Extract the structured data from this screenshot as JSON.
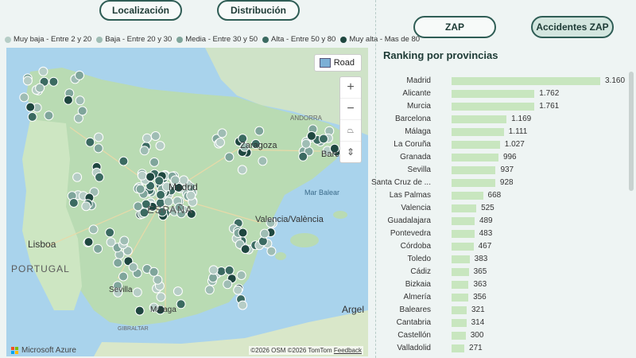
{
  "buttons": {
    "localizacion": "Localización",
    "distribucion": "Distribución",
    "zap": "ZAP",
    "accidentes_zap": "Accidentes ZAP"
  },
  "legend": [
    {
      "label": "Muy baja - Entre 2 y 20",
      "color": "#b6cdc6"
    },
    {
      "label": "Baja - Entre 20 y 30",
      "color": "#9fbdb4"
    },
    {
      "label": "Media - Entre 30 y 50",
      "color": "#7fa59b"
    },
    {
      "label": "Alta - Entre 50 y 80",
      "color": "#3b6a61"
    },
    {
      "label": "Muy alta - Mas de 80",
      "color": "#1f4740"
    }
  ],
  "map": {
    "labels": {
      "madrid": "Madrid",
      "espana": "ESPAÑA",
      "zaragoza": "Zaragoza",
      "valencia": "Valencia/València",
      "lisboa": "Lisboa",
      "portugal": "PORTUGAL",
      "sevilla": "Sevilla",
      "malaga": "Málaga",
      "argel": "Argel",
      "mar_balear": "Mar Balear",
      "andorra": "ANDORRA",
      "barcelona": "Barce",
      "gibraltar": "GIBRALTAR"
    },
    "road_button": "Road",
    "attribution": "©2026 OSM  ©2026 TomTom",
    "feedback": "Feedback",
    "brand": "Microsoft Azure"
  },
  "ranking": {
    "title": "Ranking por provincias",
    "max": 3160,
    "items": [
      {
        "name": "Madrid",
        "value": 3160,
        "label": "3.160"
      },
      {
        "name": "Alicante",
        "value": 1762,
        "label": "1.762"
      },
      {
        "name": "Murcia",
        "value": 1761,
        "label": "1.761"
      },
      {
        "name": "Barcelona",
        "value": 1169,
        "label": "1.169"
      },
      {
        "name": "Málaga",
        "value": 1111,
        "label": "1.111"
      },
      {
        "name": "La Coruña",
        "value": 1027,
        "label": "1.027"
      },
      {
        "name": "Granada",
        "value": 996,
        "label": "996"
      },
      {
        "name": "Sevilla",
        "value": 937,
        "label": "937"
      },
      {
        "name": "Santa Cruz de ...",
        "value": 928,
        "label": "928"
      },
      {
        "name": "Las Palmas",
        "value": 668,
        "label": "668"
      },
      {
        "name": "Valencia",
        "value": 525,
        "label": "525"
      },
      {
        "name": "Guadalajara",
        "value": 489,
        "label": "489"
      },
      {
        "name": "Pontevedra",
        "value": 483,
        "label": "483"
      },
      {
        "name": "Córdoba",
        "value": 467,
        "label": "467"
      },
      {
        "name": "Toledo",
        "value": 383,
        "label": "383"
      },
      {
        "name": "Cádiz",
        "value": 365,
        "label": "365"
      },
      {
        "name": "Bizkaia",
        "value": 363,
        "label": "363"
      },
      {
        "name": "Almería",
        "value": 356,
        "label": "356"
      },
      {
        "name": "Baleares",
        "value": 321,
        "label": "321"
      },
      {
        "name": "Cantabria",
        "value": 314,
        "label": "314"
      },
      {
        "name": "Castellón",
        "value": 300,
        "label": "300"
      },
      {
        "name": "Valladolid",
        "value": 271,
        "label": "271"
      }
    ]
  }
}
